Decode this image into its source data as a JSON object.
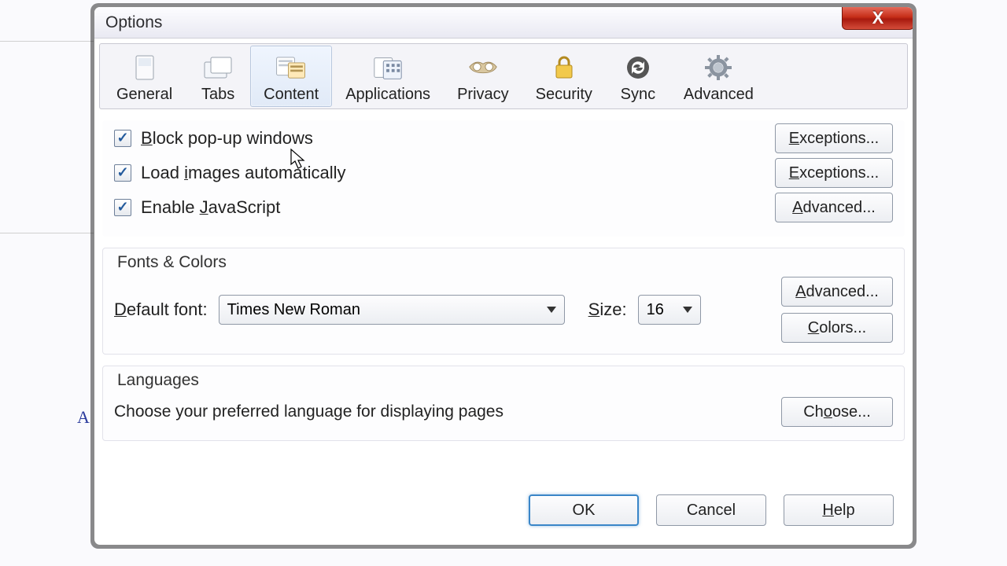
{
  "window": {
    "title": "Options",
    "close_glyph": "X"
  },
  "toolbar": [
    {
      "id": "general",
      "label": "General",
      "selected": false
    },
    {
      "id": "tabs",
      "label": "Tabs",
      "selected": false
    },
    {
      "id": "content",
      "label": "Content",
      "selected": true
    },
    {
      "id": "applications",
      "label": "Applications",
      "selected": false
    },
    {
      "id": "privacy",
      "label": "Privacy",
      "selected": false
    },
    {
      "id": "security",
      "label": "Security",
      "selected": false
    },
    {
      "id": "sync",
      "label": "Sync",
      "selected": false
    },
    {
      "id": "advanced",
      "label": "Advanced",
      "selected": false
    }
  ],
  "content_tab": {
    "checks": {
      "block_popups": {
        "label": "Block pop-up windows",
        "checked": true,
        "button": "Exceptions..."
      },
      "load_images": {
        "label": "Load images automatically",
        "checked": true,
        "button": "Exceptions..."
      },
      "enable_js": {
        "label": "Enable JavaScript",
        "checked": true,
        "button": "Advanced..."
      }
    },
    "fonts": {
      "group_title": "Fonts & Colors",
      "default_font_label": "Default font:",
      "default_font_value": "Times New Roman",
      "size_label": "Size:",
      "size_value": "16",
      "advanced_btn": "Advanced...",
      "colors_btn": "Colors..."
    },
    "languages": {
      "group_title": "Languages",
      "desc": "Choose your preferred language for displaying pages",
      "choose_btn": "Choose..."
    }
  },
  "buttons": {
    "ok": "OK",
    "cancel": "Cancel",
    "help": "Help"
  },
  "bg_snippet": "A"
}
